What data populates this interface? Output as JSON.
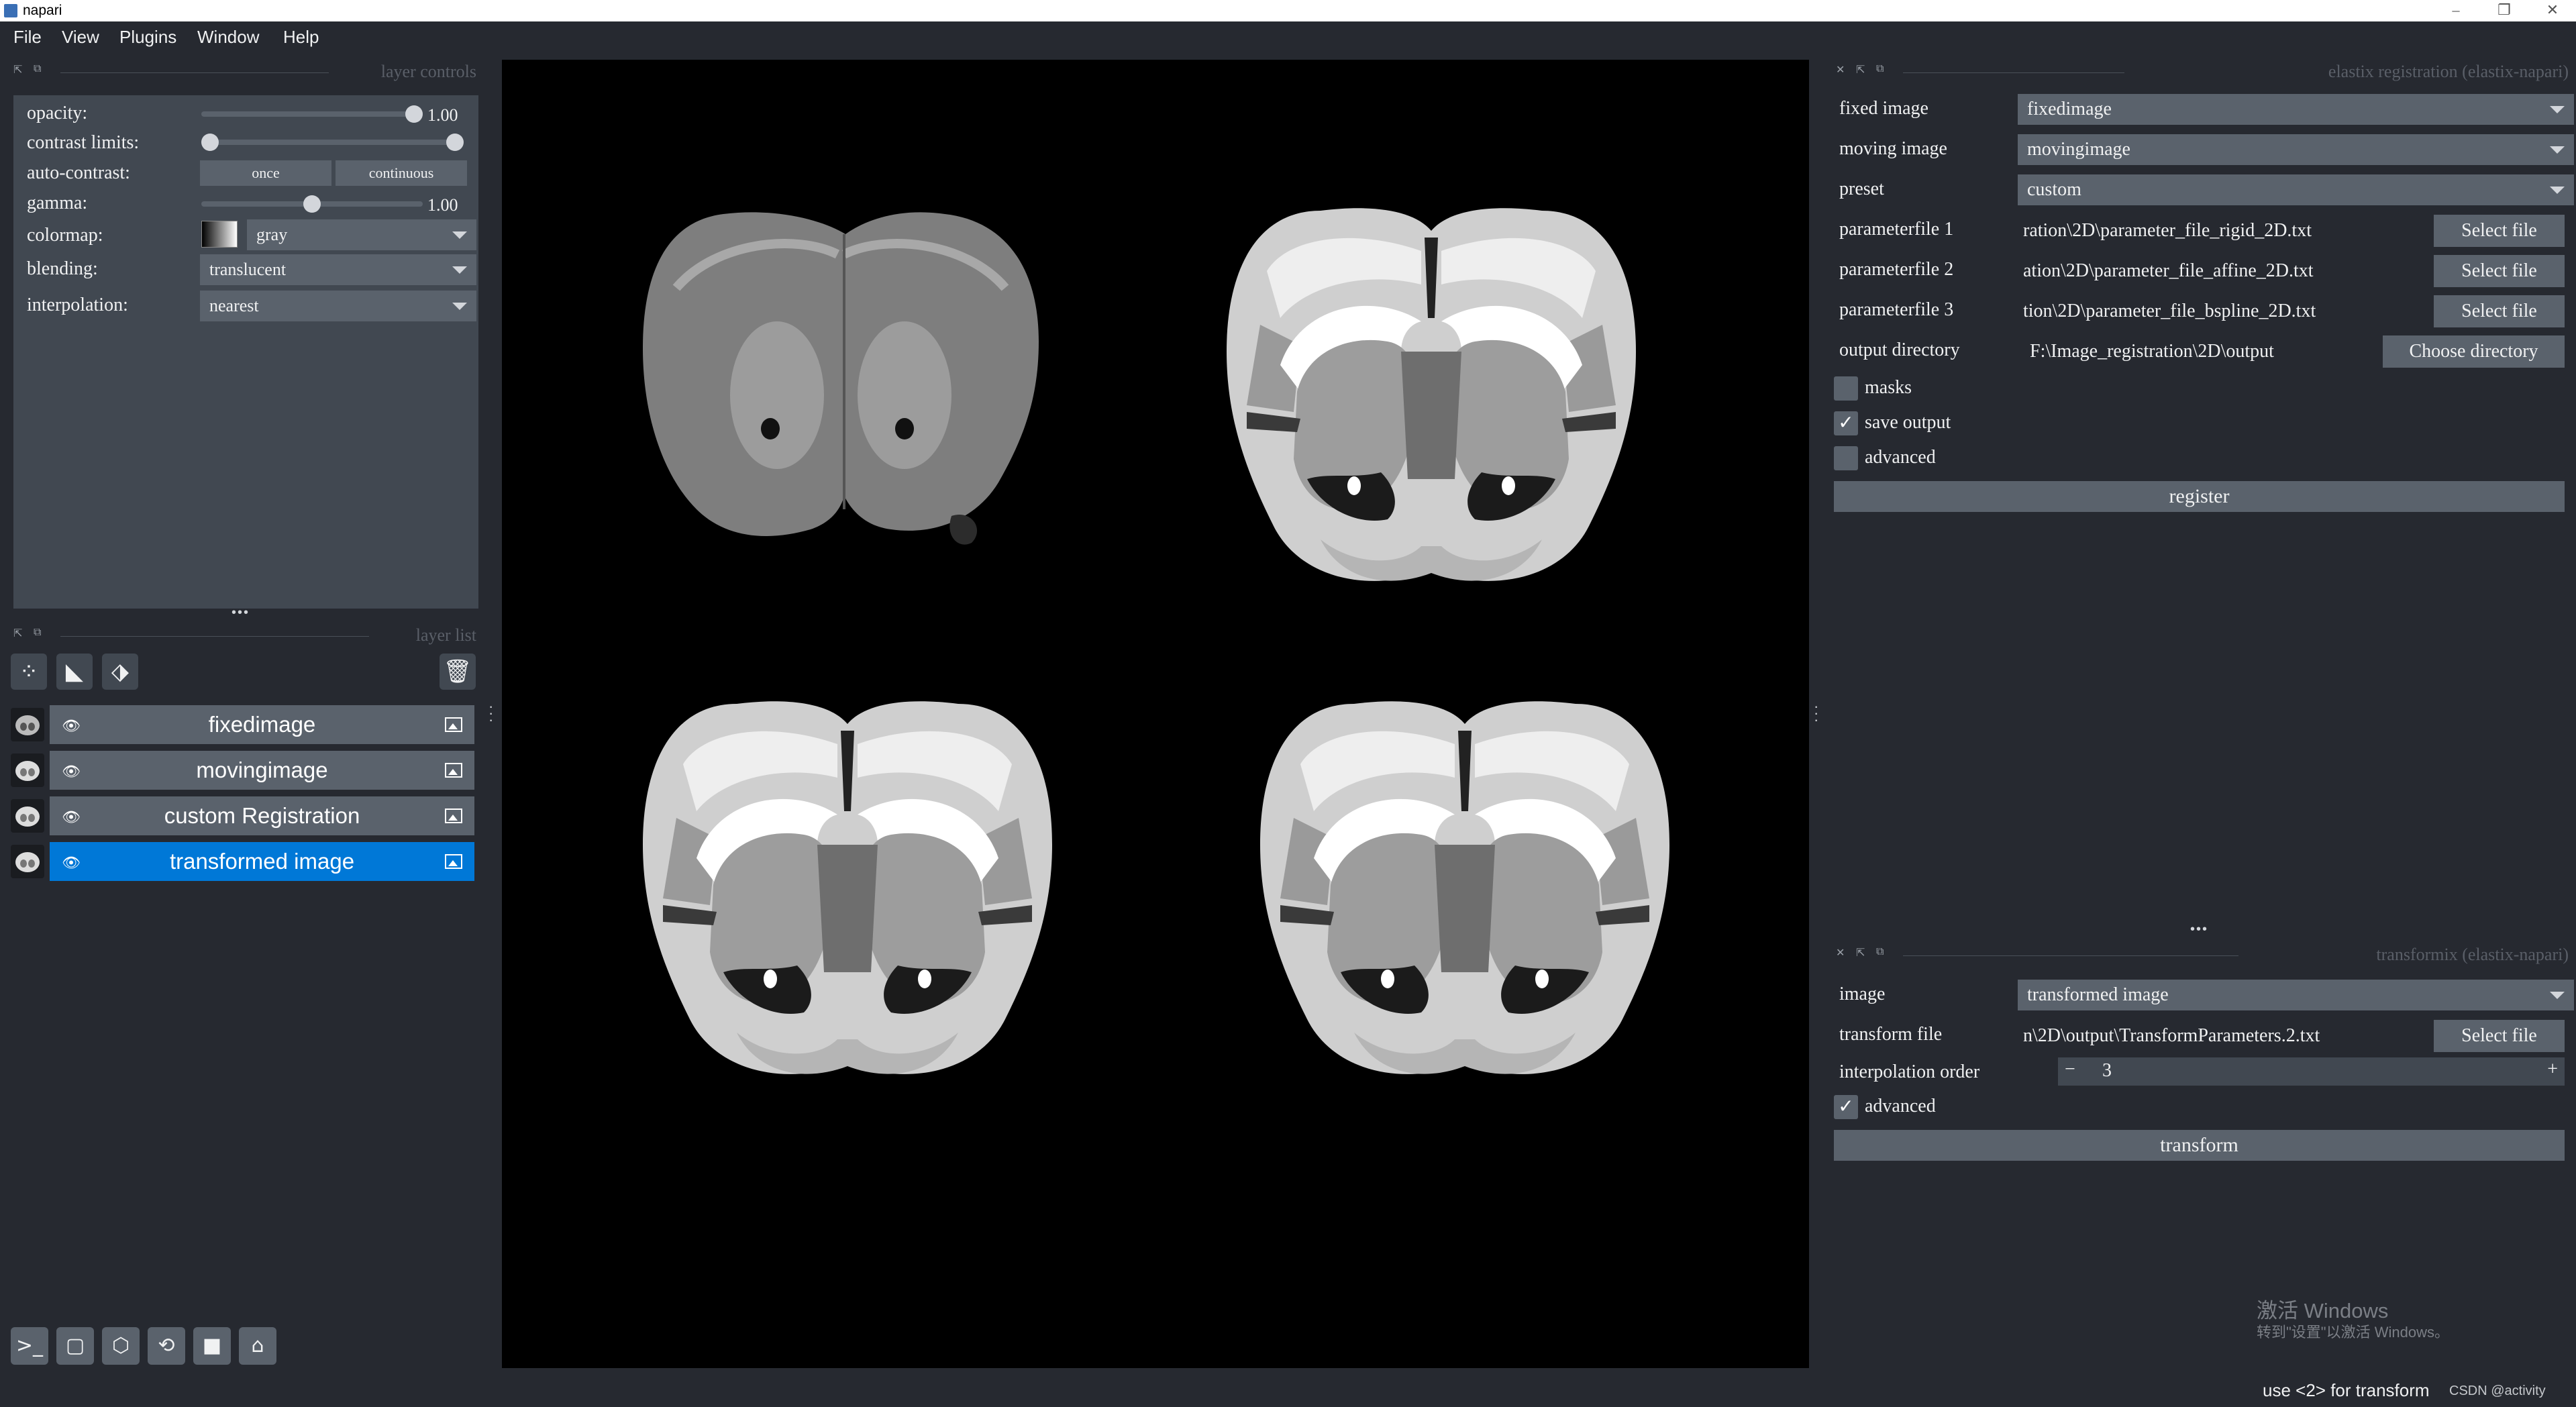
{
  "window": {
    "title": "napari",
    "controls": [
      "–",
      "❐",
      "✕"
    ]
  },
  "menu": [
    "File",
    "View",
    "Plugins",
    "Window",
    "Help"
  ],
  "layer_controls": {
    "header": "layer controls",
    "opacity": {
      "label": "opacity:",
      "value": "1.00",
      "level": 1.0
    },
    "contrast_limits": {
      "label": "contrast limits:",
      "low": 0.0,
      "high": 1.0
    },
    "auto_contrast": {
      "label": "auto-contrast:",
      "once": "once",
      "continuous": "continuous"
    },
    "gamma": {
      "label": "gamma:",
      "value": "1.00",
      "level": 0.5
    },
    "colormap": {
      "label": "colormap:",
      "value": "gray"
    },
    "blending": {
      "label": "blending:",
      "value": "translucent"
    },
    "interpolation": {
      "label": "interpolation:",
      "value": "nearest"
    }
  },
  "layer_list": {
    "header": "layer list",
    "ellipsis": "•••",
    "layers": [
      {
        "name": "fixedimage",
        "selected": false
      },
      {
        "name": "movingimage",
        "selected": false
      },
      {
        "name": "custom Registration",
        "selected": false
      },
      {
        "name": "transformed image",
        "selected": true
      }
    ]
  },
  "elastix": {
    "header": "elastix registration (elastix-napari)",
    "fixed_image": {
      "label": "fixed image",
      "value": "fixedimage"
    },
    "moving_image": {
      "label": "moving image",
      "value": "movingimage"
    },
    "preset": {
      "label": "preset",
      "value": "custom"
    },
    "param1": {
      "label": "parameterfile 1",
      "value": "ration\\2D\\parameter_file_rigid_2D.txt",
      "button": "Select file"
    },
    "param2": {
      "label": "parameterfile 2",
      "value": "ation\\2D\\parameter_file_affine_2D.txt",
      "button": "Select file"
    },
    "param3": {
      "label": "parameterfile 3",
      "value": "tion\\2D\\parameter_file_bspline_2D.txt",
      "button": "Select file"
    },
    "output_dir": {
      "label": "output directory",
      "value": "F:\\Image_registration\\2D\\output",
      "button": "Choose directory"
    },
    "masks": {
      "label": "masks",
      "checked": false
    },
    "save_output": {
      "label": "save output",
      "checked": true
    },
    "advanced": {
      "label": "advanced",
      "checked": false
    },
    "register": "register"
  },
  "transformix": {
    "ellipsis": "•••",
    "header": "transformix (elastix-napari)",
    "image": {
      "label": "image",
      "value": "transformed image"
    },
    "transform_file": {
      "label": "transform file",
      "value": "n\\2D\\output\\TransformParameters.2.txt",
      "button": "Select file"
    },
    "interp_order": {
      "label": "interpolation order",
      "minus": "−",
      "value": "3",
      "plus": "+"
    },
    "advanced": {
      "label": "advanced",
      "checked": true
    },
    "transform": "transform"
  },
  "watermark": {
    "line1": "激活 Windows",
    "line2": "转到\"设置\"以激活 Windows。"
  },
  "status": {
    "text": "use <2> for transform",
    "right": "CSDN @activity"
  },
  "checkmark": "✓"
}
